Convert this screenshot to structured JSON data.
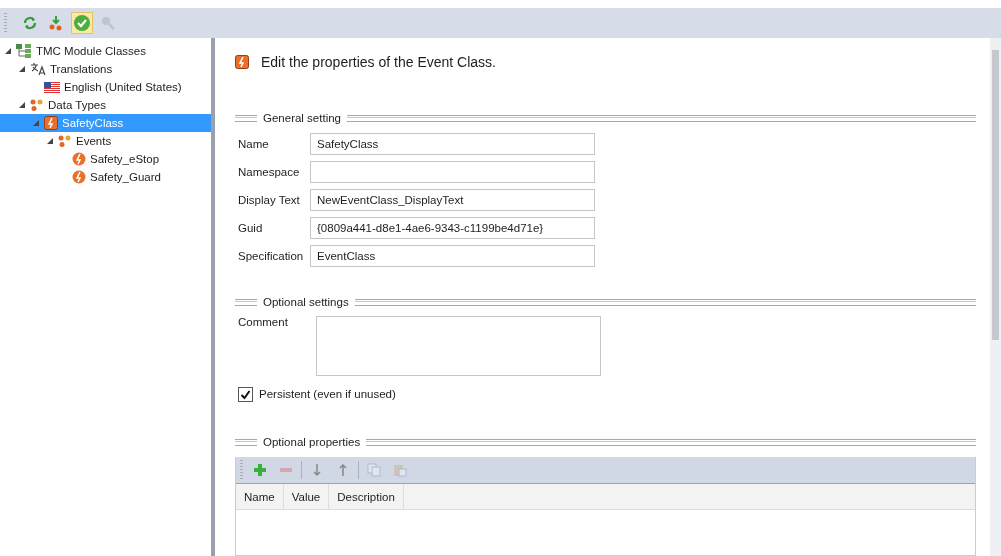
{
  "toolbar": [
    {
      "kind": "refresh",
      "pressed": false,
      "disabled": false
    },
    {
      "kind": "download",
      "pressed": false,
      "disabled": false
    },
    {
      "kind": "check",
      "pressed": true,
      "disabled": false
    },
    {
      "kind": "zoom",
      "pressed": false,
      "disabled": true
    }
  ],
  "tree": [
    {
      "label": "TMC Module Classes",
      "kind": "module",
      "expanded": true,
      "selected": false,
      "children": [
        {
          "label": "Translations",
          "kind": "translations",
          "expanded": true,
          "selected": false,
          "children": [
            {
              "label": "English (United States)",
              "kind": "flag",
              "selected": false
            }
          ]
        },
        {
          "label": "Data Types",
          "kind": "datatypes",
          "expanded": true,
          "selected": false,
          "children": [
            {
              "label": "SafetyClass",
              "kind": "eventclass",
              "expanded": true,
              "selected": true,
              "children": [
                {
                  "label": "Events",
                  "kind": "datatypes",
                  "expanded": true,
                  "selected": false,
                  "children": [
                    {
                      "label": "Safety_eStop",
                      "kind": "event",
                      "selected": false
                    },
                    {
                      "label": "Safety_Guard",
                      "kind": "event",
                      "selected": false
                    }
                  ]
                }
              ]
            }
          ]
        }
      ]
    }
  ],
  "header": {
    "title": "Edit the properties of the Event Class."
  },
  "general": {
    "title": "General setting",
    "fields": [
      {
        "label": "Name",
        "value": "SafetyClass"
      },
      {
        "label": "Namespace"
      },
      {
        "label": "Display Text",
        "value": "NewEventClass_DisplayText"
      },
      {
        "label": "Guid",
        "value": "{0809a441-d8e1-4ae6-9343-c1199be4d71e}"
      },
      {
        "label": "Specification",
        "value": "EventClass"
      }
    ]
  },
  "optional_settings": {
    "title": "Optional settings",
    "comment": {
      "label": "Comment"
    },
    "persistent": {
      "label": "Persistent (even if unused)",
      "checked": true
    }
  },
  "optional_properties": {
    "title": "Optional properties",
    "toolbar": [
      {
        "kind": "add",
        "disabled": false
      },
      {
        "kind": "remove",
        "disabled": true
      },
      {
        "kind": "sep"
      },
      {
        "kind": "down",
        "disabled": false
      },
      {
        "kind": "up",
        "disabled": false
      },
      {
        "kind": "sep"
      },
      {
        "kind": "copy",
        "disabled": true
      },
      {
        "kind": "paste",
        "disabled": true
      }
    ],
    "columns": [
      "Name",
      "Value",
      "Description"
    ]
  }
}
